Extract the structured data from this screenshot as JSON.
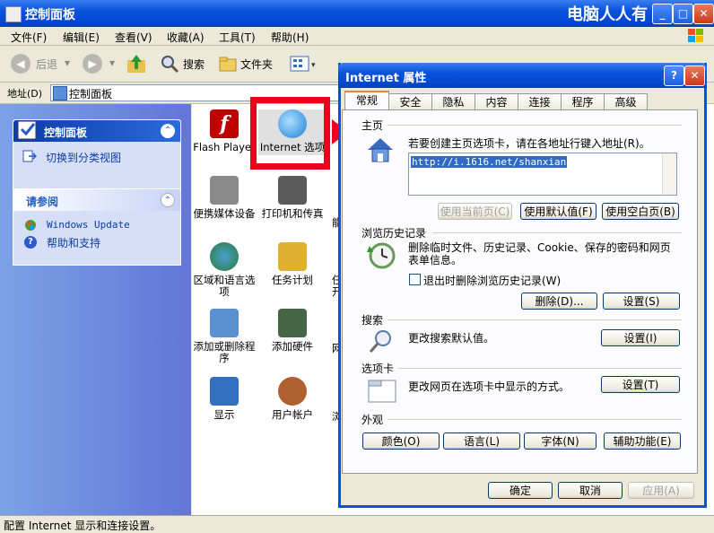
{
  "window": {
    "title": "控制面板",
    "watermark": "电脑人人有"
  },
  "menu": [
    "文件(F)",
    "编辑(E)",
    "查看(V)",
    "收藏(A)",
    "工具(T)",
    "帮助(H)"
  ],
  "toolbar": {
    "back": "后退",
    "search": "搜索",
    "folders": "文件夹",
    "ie_tab_label": "搜索"
  },
  "address": {
    "label": "地址(D)",
    "value": "控制面板"
  },
  "left_pane": {
    "panel1_title": "控制面板",
    "panel1_link": "切换到分类视图",
    "panel2_title": "请参阅",
    "panel2_links": [
      "Windows Update",
      "帮助和支持"
    ]
  },
  "content": {
    "items": [
      {
        "label": "Flash Player",
        "icon": "flash-icon",
        "color": "#c00000"
      },
      {
        "label": "Internet 选项",
        "icon": "internet-globe-icon",
        "color": "#1e7fd4"
      },
      {
        "label": "便携媒体设备",
        "icon": "portable-media-icon",
        "color": "#777777"
      },
      {
        "label": "打印机和传真",
        "icon": "printer-icon",
        "color": "#555555"
      },
      {
        "label": "区域和语言选项",
        "icon": "globe-icon",
        "color": "#2a7a3a"
      },
      {
        "label": "任务计划",
        "icon": "scheduled-tasks-icon",
        "color": "#e0b030"
      },
      {
        "label": "添加或删除程序",
        "icon": "add-remove-icon",
        "color": "#5a8fd0"
      },
      {
        "label": "添加硬件",
        "icon": "add-hardware-icon",
        "color": "#446644"
      },
      {
        "label": "显示",
        "icon": "display-icon",
        "color": "#3370c0"
      },
      {
        "label": "用户帐户",
        "icon": "user-accounts-icon",
        "color": "#b06030"
      }
    ],
    "partial_labels": [
      "能",
      "任开",
      "网",
      "浏"
    ]
  },
  "status": "配置 Internet 显示和连接设置。",
  "dialog": {
    "title": "Internet 属性",
    "tabs": [
      "常规",
      "安全",
      "隐私",
      "内容",
      "连接",
      "程序",
      "高级"
    ],
    "active_tab": 0,
    "home": {
      "header": "主页",
      "desc": "若要创建主页选项卡，请在各地址行键入地址(R)。",
      "url": "http://i.1616.net/shanxian",
      "btn_current": "使用当前页(C)",
      "btn_default": "使用默认值(F)",
      "btn_blank": "使用空白页(B)"
    },
    "history": {
      "header": "浏览历史记录",
      "desc": "删除临时文件、历史记录、Cookie、保存的密码和网页表单信息。",
      "checkbox": "退出时删除浏览历史记录(W)",
      "btn_delete": "删除(D)...",
      "btn_settings": "设置(S)"
    },
    "search": {
      "header": "搜索",
      "desc": "更改搜索默认值。",
      "btn": "设置(I)"
    },
    "tabs_section": {
      "header": "选项卡",
      "desc": "更改网页在选项卡中显示的方式。",
      "btn": "设置(T)"
    },
    "appearance": {
      "header": "外观",
      "btn_colors": "颜色(O)",
      "btn_lang": "语言(L)",
      "btn_fonts": "字体(N)",
      "btn_access": "辅助功能(E)"
    },
    "ok": "确定",
    "cancel": "取消",
    "apply": "应用(A)"
  }
}
